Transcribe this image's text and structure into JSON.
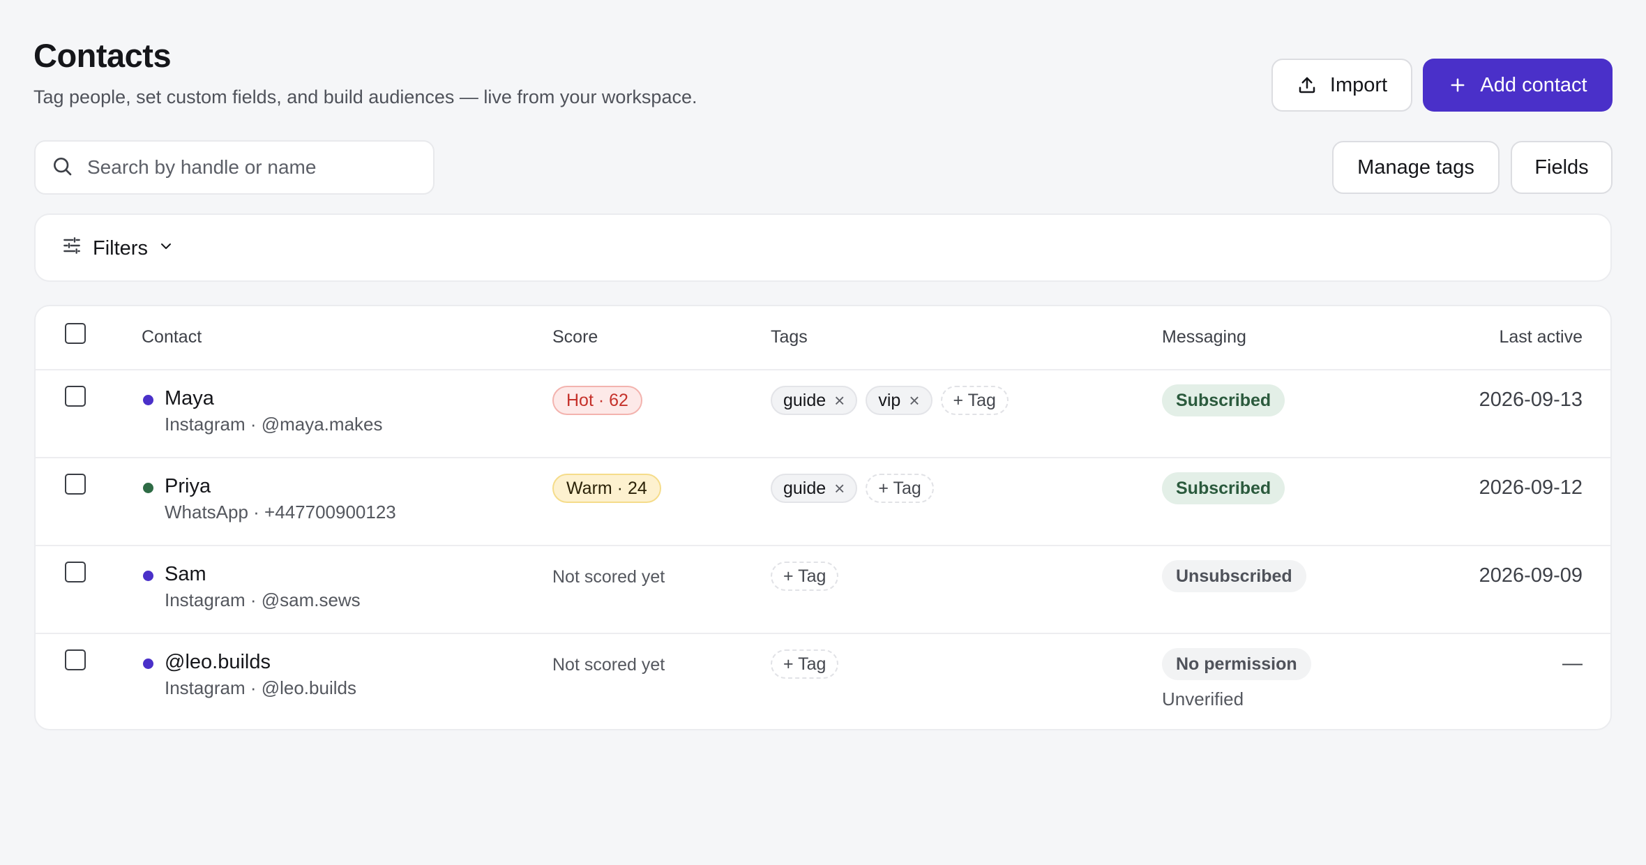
{
  "header": {
    "title": "Contacts",
    "subtitle": "Tag people, set custom fields, and build audiences — live from your workspace.",
    "import_label": "Import",
    "add_contact_label": "Add contact"
  },
  "search": {
    "placeholder": "Search by handle or name"
  },
  "toolbar": {
    "manage_tags_label": "Manage tags",
    "fields_label": "Fields"
  },
  "filters": {
    "label": "Filters"
  },
  "table": {
    "columns": {
      "contact": "Contact",
      "score": "Score",
      "tags": "Tags",
      "messaging": "Messaging",
      "last_active": "Last active"
    },
    "add_tag_label": "+ Tag",
    "rows": [
      {
        "name": "Maya",
        "sub": "Instagram · @maya.makes",
        "dot_color": "#4a30c9",
        "score": "Hot · 62",
        "tags": [
          "guide",
          "vip"
        ],
        "messaging": "Subscribed",
        "last_active": "2026-09-13"
      },
      {
        "name": "Priya",
        "sub": "WhatsApp · +447700900123",
        "dot_color": "#2e6b45",
        "score": "Warm · 24",
        "tags": [
          "guide"
        ],
        "messaging": "Subscribed",
        "last_active": "2026-09-12"
      },
      {
        "name": "Sam",
        "sub": "Instagram · @sam.sews",
        "dot_color": "#4a30c9",
        "score": "Not scored yet",
        "tags": [],
        "messaging": "Unsubscribed",
        "last_active": "2026-09-09"
      },
      {
        "name": "@leo.builds",
        "sub": "Instagram · @leo.builds",
        "dot_color": "#4a30c9",
        "score": "Not scored yet",
        "tags": [],
        "messaging": "No permission",
        "messaging_note": "Unverified",
        "last_active": "—"
      }
    ]
  },
  "colors": {
    "accent": "#4a30c9",
    "hot": "#c5312a",
    "warm_bg": "#fdf1cf",
    "subscribed_bg": "#e3efe7",
    "subscribed_text": "#2b5a3d"
  }
}
